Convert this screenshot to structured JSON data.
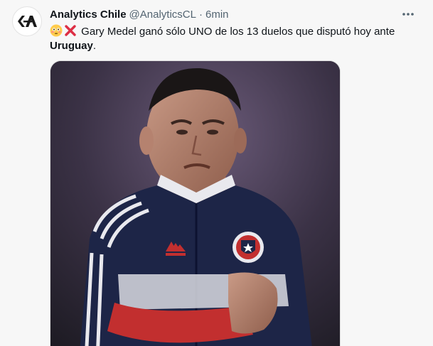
{
  "tweet": {
    "display_name": "Analytics Chile",
    "handle": "@AnalyticsCL",
    "separator": "·",
    "time": "6min",
    "text_emojis": [
      "flushed-face",
      "cross-mark"
    ],
    "text_part1": "Gary Medel ganó sólo UNO de los 13 duelos que disputó hoy ante ",
    "text_bold": "Uruguay",
    "text_end": "."
  },
  "media": {
    "subject": "player-photo",
    "jersey_colors": {
      "navy": "#1d2547",
      "red": "#c22f2f",
      "white": "#e9e9ee"
    }
  },
  "colors": {
    "background": "#f7f7f7",
    "text": "#0f1419",
    "secondary": "#536471"
  }
}
